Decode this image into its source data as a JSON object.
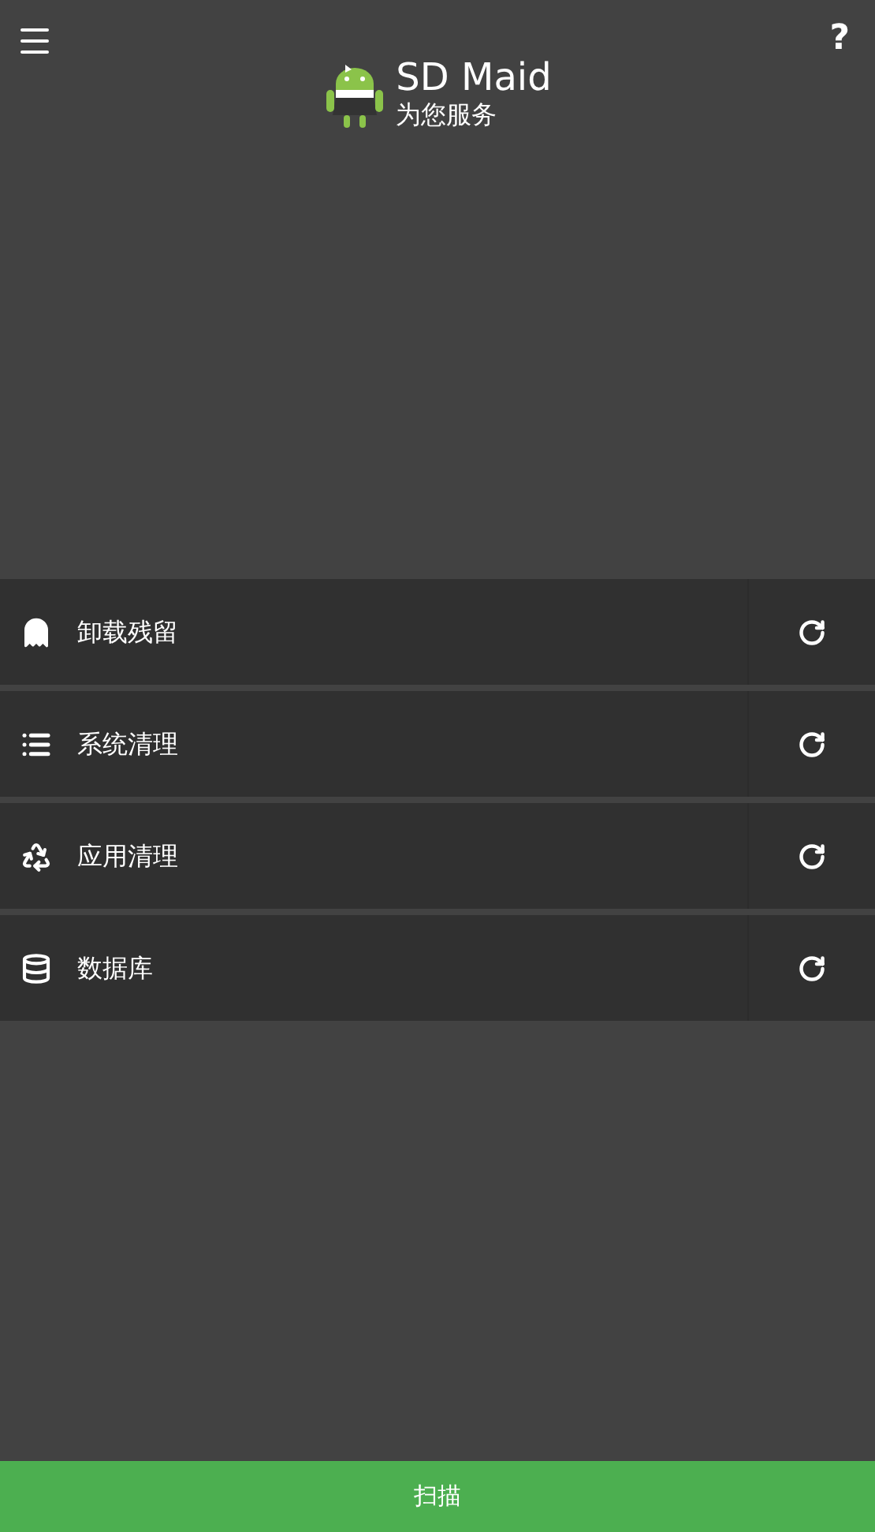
{
  "app_bar": {
    "title": "SD Maid",
    "subtitle": "为您服务"
  },
  "tools": [
    {
      "kind": "ghost",
      "label": "卸载残留"
    },
    {
      "kind": "list",
      "label": "系统清理"
    },
    {
      "kind": "recycle",
      "label": "应用清理"
    },
    {
      "kind": "database",
      "label": "数据库"
    }
  ],
  "scan_button": "扫描",
  "help_button": "?"
}
